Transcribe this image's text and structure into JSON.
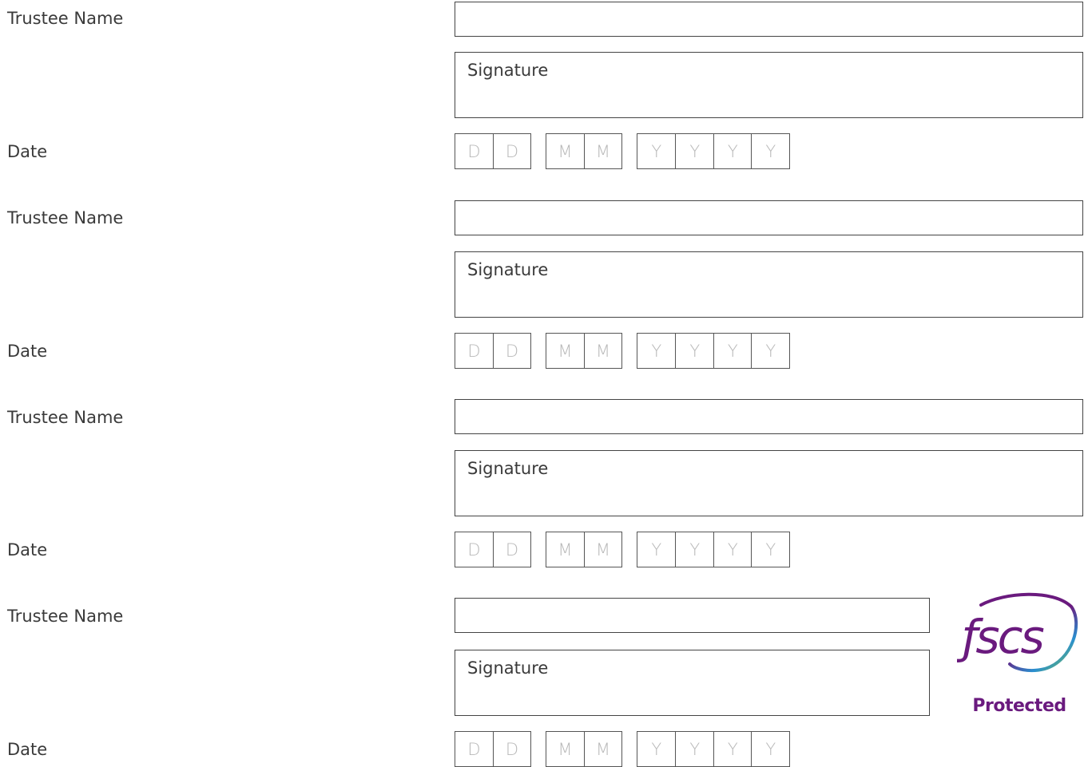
{
  "blocks": [
    {
      "name_label": "Trustee Name",
      "signature_label": "Signature",
      "date_label": "Date",
      "date_placeholders": {
        "day": [
          "D",
          "D"
        ],
        "month": [
          "M",
          "M"
        ],
        "year": [
          "Y",
          "Y",
          "Y",
          "Y"
        ]
      }
    },
    {
      "name_label": "Trustee Name",
      "signature_label": "Signature",
      "date_label": "Date",
      "date_placeholders": {
        "day": [
          "D",
          "D"
        ],
        "month": [
          "M",
          "M"
        ],
        "year": [
          "Y",
          "Y",
          "Y",
          "Y"
        ]
      }
    },
    {
      "name_label": "Trustee Name",
      "signature_label": "Signature",
      "date_label": "Date",
      "date_placeholders": {
        "day": [
          "D",
          "D"
        ],
        "month": [
          "M",
          "M"
        ],
        "year": [
          "Y",
          "Y",
          "Y",
          "Y"
        ]
      }
    },
    {
      "name_label": "Trustee Name",
      "signature_label": "Signature",
      "date_label": "Date",
      "date_placeholders": {
        "day": [
          "D",
          "D"
        ],
        "month": [
          "M",
          "M"
        ],
        "year": [
          "Y",
          "Y",
          "Y",
          "Y"
        ]
      }
    }
  ],
  "fscs": {
    "logo_text": "fscs",
    "caption": "Protected",
    "brand_color": "#6a1a7e",
    "accent_colors": [
      "#6a1a7e",
      "#2a8fd0",
      "#7cc242"
    ]
  }
}
